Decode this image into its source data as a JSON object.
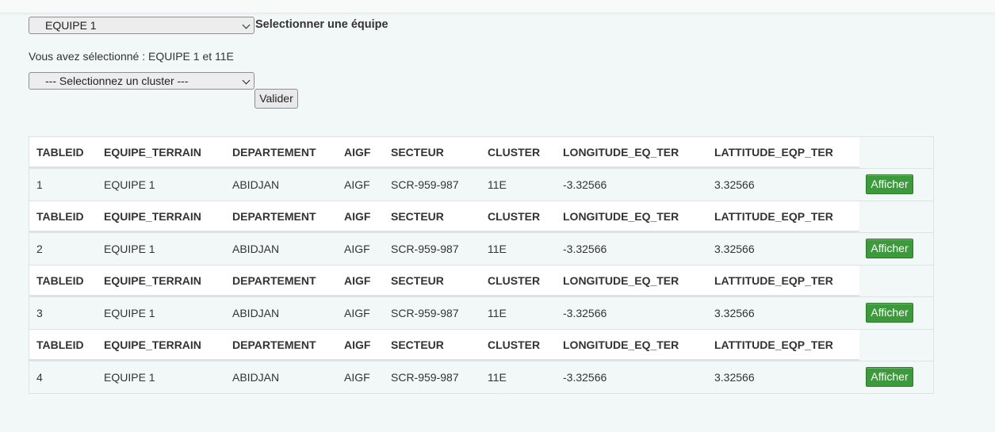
{
  "team_select": {
    "value": "EQUIPE 1",
    "label": "Selectionner une équipe"
  },
  "selected_info": "Vous avez sélectionné : EQUIPE 1 et 11E",
  "cluster_select": {
    "value": "--- Selectionnez un cluster ---"
  },
  "validate_label": "Valider",
  "table": {
    "headers": [
      "TABLEID",
      "EQUIPE_TERRAIN",
      "DEPARTEMENT",
      "AIGF",
      "SECTEUR",
      "CLUSTER",
      "LONGITUDE_EQ_TER",
      "LATTITUDE_EQP_TER"
    ],
    "rows": [
      [
        "1",
        "EQUIPE 1",
        "ABIDJAN",
        "AIGF",
        "SCR-959-987",
        "11E",
        "-3.32566",
        "3.32566"
      ],
      [
        "2",
        "EQUIPE 1",
        "ABIDJAN",
        "AIGF",
        "SCR-959-987",
        "11E",
        "-3.32566",
        "3.32566"
      ],
      [
        "3",
        "EQUIPE 1",
        "ABIDJAN",
        "AIGF",
        "SCR-959-987",
        "11E",
        "-3.32566",
        "3.32566"
      ],
      [
        "4",
        "EQUIPE 1",
        "ABIDJAN",
        "AIGF",
        "SCR-959-987",
        "11E",
        "-3.32566",
        "3.32566"
      ]
    ],
    "action_label": "Afficher"
  }
}
